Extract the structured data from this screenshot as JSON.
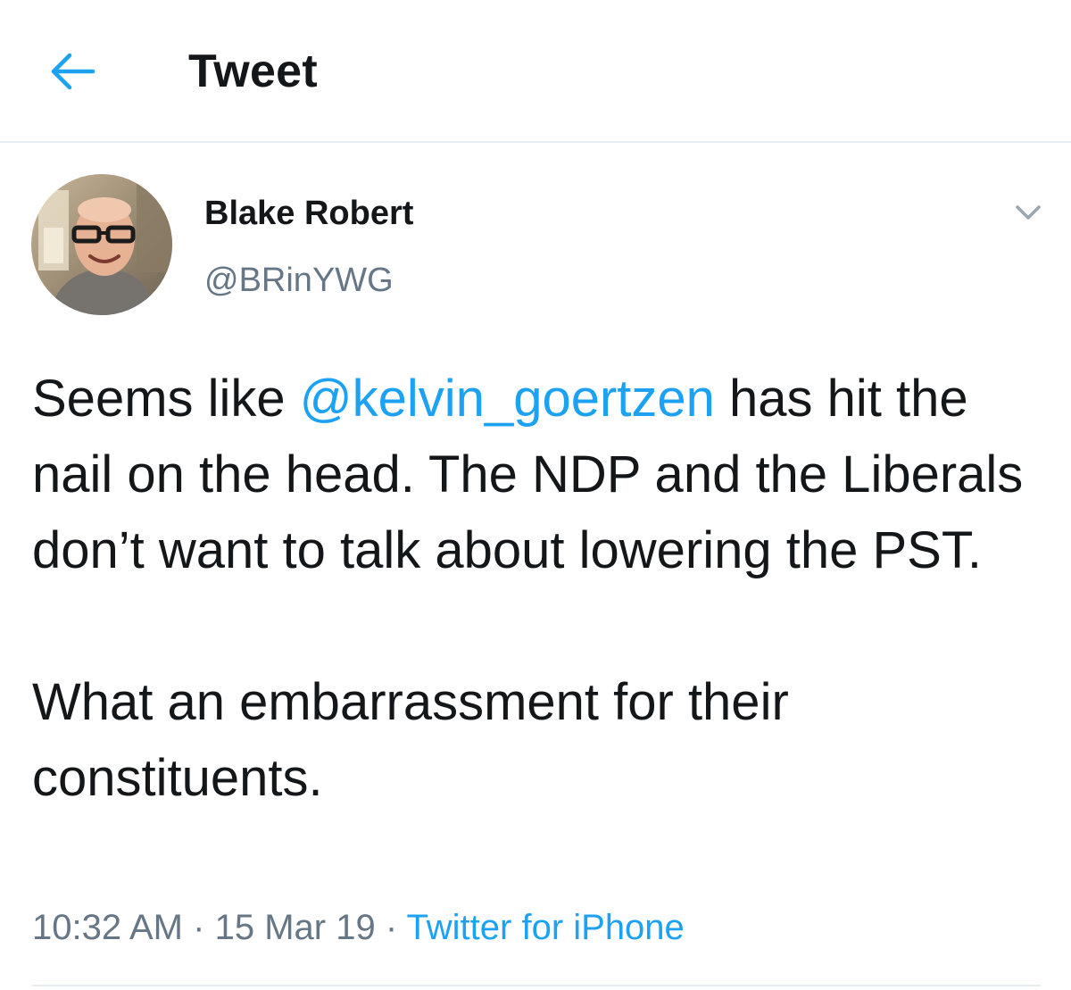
{
  "header": {
    "title": "Tweet",
    "back_icon": "arrow-left-icon"
  },
  "tweet": {
    "author": {
      "display_name": "Blake Robert",
      "handle": "@BRinYWG"
    },
    "menu_icon": "chevron-down-icon",
    "text": {
      "before_mention": "Seems like ",
      "mention": "@kelvin_goertzen",
      "after_mention": " has hit the nail on the head. The NDP and the Liberals don’t want to talk about lowering the PST.\n\nWhat an embarrassment for their constituents."
    },
    "meta": {
      "time": "10:32 AM",
      "separator": "·",
      "date": "15 Mar 19",
      "source": "Twitter for iPhone"
    }
  },
  "colors": {
    "accent": "#1da1f2",
    "text": "#14171a",
    "secondary_text": "#657786",
    "divider": "#e6ecf0"
  }
}
